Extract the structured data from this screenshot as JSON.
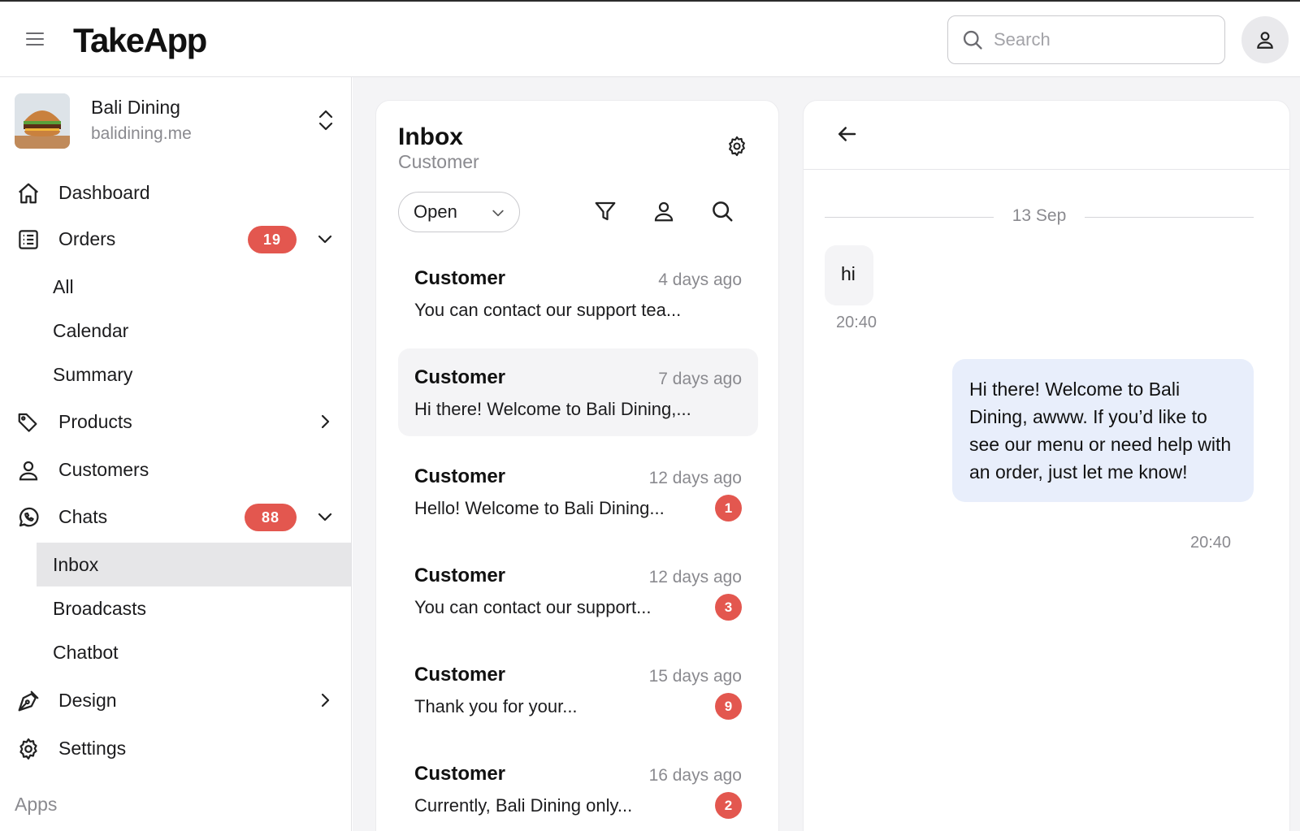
{
  "app": {
    "brand": "TakeApp"
  },
  "search": {
    "placeholder": "Search"
  },
  "store": {
    "name": "Bali Dining",
    "url": "balidining.me"
  },
  "sidebar": {
    "dashboard": "Dashboard",
    "orders": {
      "label": "Orders",
      "badge": "19",
      "sub": [
        "All",
        "Calendar",
        "Summary"
      ]
    },
    "products": "Products",
    "customers": "Customers",
    "chats": {
      "label": "Chats",
      "badge": "88",
      "sub": [
        "Inbox",
        "Broadcasts",
        "Chatbot"
      ]
    },
    "design": "Design",
    "settings": "Settings",
    "apps_section": "Apps"
  },
  "inbox": {
    "title": "Inbox",
    "subtitle": "Customer",
    "status_filter": "Open",
    "conversations": [
      {
        "name": "Customer",
        "time": "4 days ago",
        "preview": "You can contact our support tea...",
        "unread": ""
      },
      {
        "name": "Customer",
        "time": "7 days ago",
        "preview": "Hi there! Welcome to Bali Dining,...",
        "unread": ""
      },
      {
        "name": "Customer",
        "time": "12 days ago",
        "preview": "Hello! Welcome to Bali Dining...",
        "unread": "1"
      },
      {
        "name": "Customer",
        "time": "12 days ago",
        "preview": "You can contact our support...",
        "unread": "3"
      },
      {
        "name": "Customer",
        "time": "15 days ago",
        "preview": "Thank you for your...",
        "unread": "9"
      },
      {
        "name": "Customer",
        "time": "16 days ago",
        "preview": "Currently, Bali Dining only...",
        "unread": "2"
      }
    ]
  },
  "chat": {
    "date_separator": "13 Sep",
    "messages": [
      {
        "direction": "incoming",
        "text": "hi",
        "time": "20:40"
      },
      {
        "direction": "outgoing",
        "text": "Hi there! Welcome to Bali Dining, awww. If you’d like to see our menu or need help with an order, just let me know!",
        "time": "20:40"
      }
    ]
  },
  "colors": {
    "badge": "#e3574f",
    "outgoing_bubble": "#e8eefb",
    "active_nav": "#e6e6e8"
  }
}
